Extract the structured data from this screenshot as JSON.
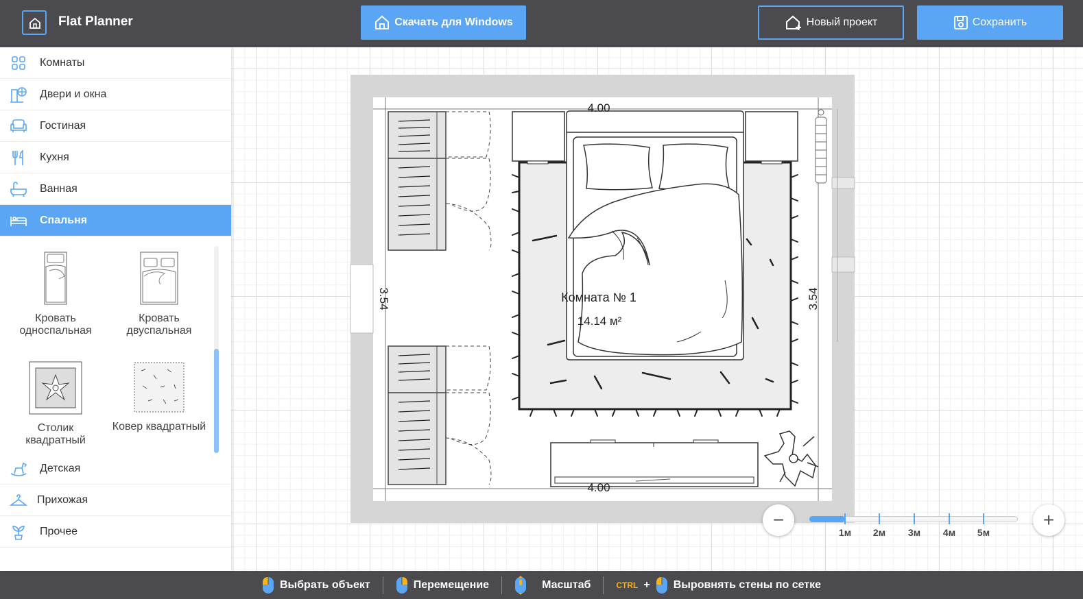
{
  "header": {
    "app_title": "Flat Planner",
    "download_label": "Скачать для Windows",
    "new_project_label": "Новый проект",
    "save_label": "Сохранить"
  },
  "sidebar": {
    "categories": [
      {
        "label": "Комнаты",
        "icon": "rooms-icon"
      },
      {
        "label": "Двери и окна",
        "icon": "doors-windows-icon"
      },
      {
        "label": "Гостиная",
        "icon": "armchair-icon"
      },
      {
        "label": "Кухня",
        "icon": "fork-knife-icon"
      },
      {
        "label": "Ванная",
        "icon": "bathtub-icon"
      },
      {
        "label": "Спальня",
        "icon": "bed-icon",
        "active": true
      },
      {
        "label": "Детская",
        "icon": "rocking-horse-icon"
      },
      {
        "label": "Прихожая",
        "icon": "hanger-icon"
      },
      {
        "label": "Прочее",
        "icon": "plant-icon"
      }
    ],
    "items": [
      {
        "label": "Кровать односпальная"
      },
      {
        "label": "Кровать двуспальная"
      },
      {
        "label": "Столик квадратный"
      },
      {
        "label": "Ковер квадратный"
      }
    ]
  },
  "plan": {
    "dim_top": "4.00",
    "dim_bottom": "4.00",
    "dim_left": "3.54",
    "dim_right": "3.54",
    "room_name": "Комната №  1",
    "room_area": "14.14 м²"
  },
  "scale": {
    "ticks": [
      "1м",
      "2м",
      "3м",
      "4м",
      "5м"
    ],
    "zoom_out": "−",
    "zoom_in": "+"
  },
  "footer": {
    "select": "Выбрать объект",
    "move": "Перемещение",
    "zoom": "Масштаб",
    "ctrl": "CTRL",
    "plus": "+",
    "align": "Выровнять стены по сетке"
  },
  "colors": {
    "accent": "#5aa6f5",
    "header_bg": "#4a4a4f",
    "wall": "#d6d6d6"
  }
}
